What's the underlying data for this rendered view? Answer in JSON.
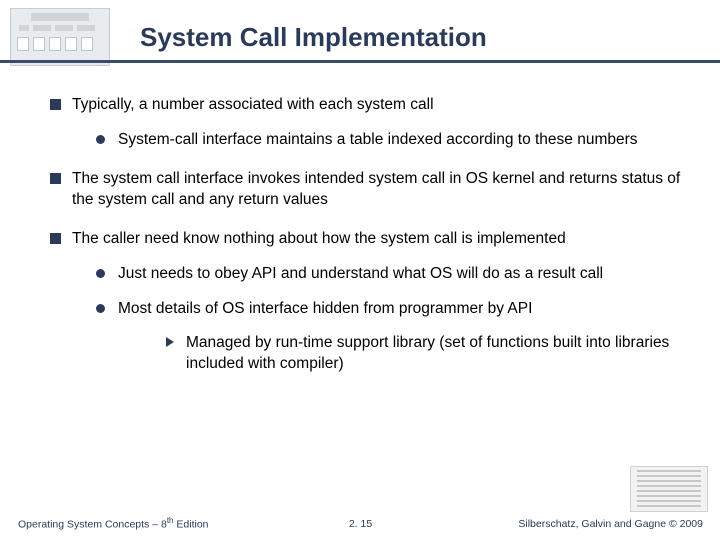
{
  "title": "System Call Implementation",
  "bullets": {
    "b1": "Typically, a number associated with each system call",
    "b1_1": "System-call interface maintains a table indexed according to these numbers",
    "b2": "The system call interface invokes intended system call in OS kernel and returns status of the system call and any return values",
    "b3": "The caller need know nothing about how the system call is implemented",
    "b3_1": "Just needs to obey API and understand what OS will do as a result call",
    "b3_2": "Most details of  OS interface hidden from programmer by API",
    "b3_2_1": "Managed by run-time support library (set of functions built into libraries included with compiler)"
  },
  "footer": {
    "left_a": "Operating System Concepts – 8",
    "left_b": " Edition",
    "left_sup": "th",
    "center": "2. 15",
    "right": "Silberschatz, Galvin and Gagne © 2009"
  }
}
